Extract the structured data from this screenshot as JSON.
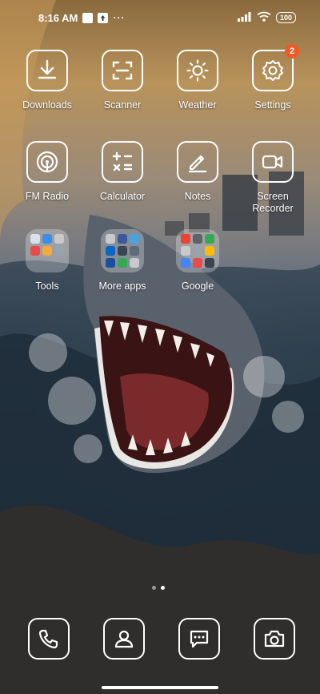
{
  "status_bar": {
    "time": "8:16 AM",
    "icons": [
      "notification-square-icon",
      "upload-square-icon",
      "more-dots-icon"
    ],
    "right_icons": [
      "signal-icon",
      "wifi-icon"
    ],
    "battery": "100"
  },
  "apps": [
    {
      "label": "Downloads",
      "icon": "download-icon"
    },
    {
      "label": "Scanner",
      "icon": "scanner-icon"
    },
    {
      "label": "Weather",
      "icon": "weather-sun-icon"
    },
    {
      "label": "Settings",
      "icon": "settings-gear-icon",
      "badge": "2"
    },
    {
      "label": "FM Radio",
      "icon": "radio-icon"
    },
    {
      "label": "Calculator",
      "icon": "calculator-icon"
    },
    {
      "label": "Notes",
      "icon": "notes-pen-icon"
    },
    {
      "label": "Screen\nRecorder",
      "icon": "video-camera-icon"
    }
  ],
  "folders": [
    {
      "label": "Tools"
    },
    {
      "label": "More apps"
    },
    {
      "label": "Google"
    }
  ],
  "dock": [
    {
      "icon": "phone-icon"
    },
    {
      "icon": "contacts-icon"
    },
    {
      "icon": "messages-icon"
    },
    {
      "icon": "camera-icon"
    }
  ],
  "page_indicator": {
    "pages": 2,
    "active": 2
  }
}
